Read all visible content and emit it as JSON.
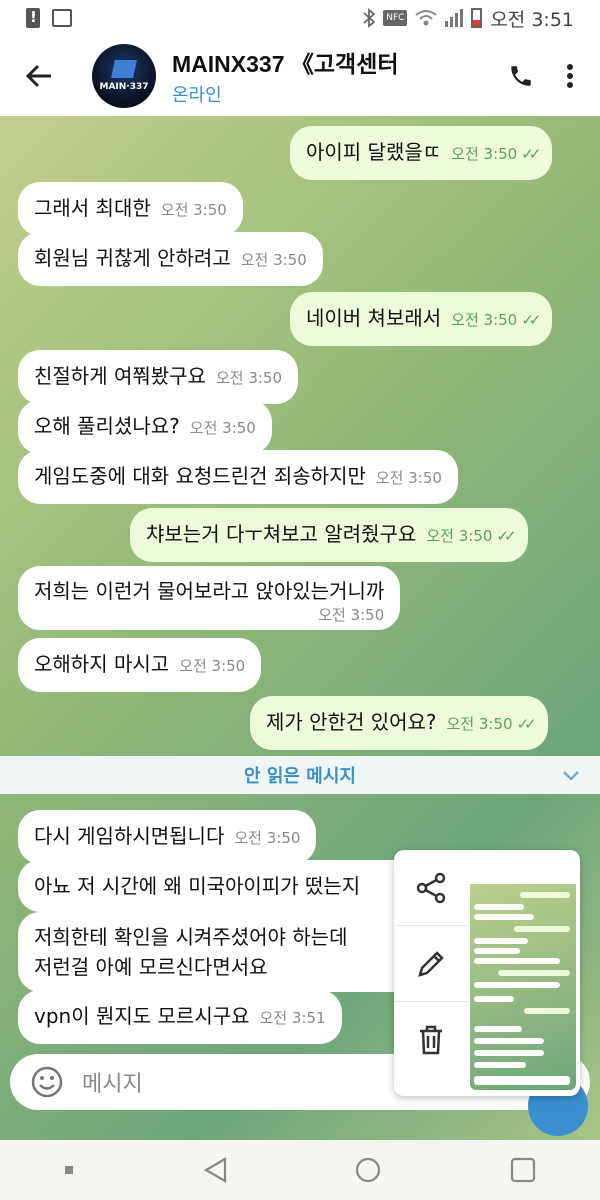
{
  "status_bar": {
    "time": "오전 3:51",
    "nfc_label": "NFC",
    "icons": [
      "alert-icon",
      "gallery-icon",
      "bluetooth-icon",
      "nfc-icon",
      "wifi-icon",
      "signal-icon",
      "battery-icon"
    ]
  },
  "header": {
    "title": "MAINX337 《고객센터",
    "status": "온라인",
    "avatar_text": "MAIN·337"
  },
  "messages": [
    {
      "dir": "out",
      "text": "아이피 달랬을ㄸ",
      "time": "오전 3:50"
    },
    {
      "dir": "in",
      "text": "그래서 최대한",
      "time": "오전 3:50"
    },
    {
      "dir": "in",
      "text": "회원님 귀찮게 안하려고",
      "time": "오전 3:50"
    },
    {
      "dir": "out",
      "text": "네이버 쳐보래서",
      "time": "오전 3:50"
    },
    {
      "dir": "in",
      "text": "친절하게 여쭤봤구요",
      "time": "오전 3:50"
    },
    {
      "dir": "in",
      "text": "오해 풀리셨나요?",
      "time": "오전 3:50"
    },
    {
      "dir": "in",
      "text": "게임도중에 대화 요청드린건 죄송하지만",
      "time": "오전 3:50"
    },
    {
      "dir": "out",
      "text": "챠보는거 다ㅜ쳐보고 알려줬구요",
      "time": "오전 3:50"
    },
    {
      "dir": "in",
      "text": "저희는 이런거 물어보라고 앉아있는거니까",
      "time": "오전 3:50"
    },
    {
      "dir": "in",
      "text": "오해하지 마시고",
      "time": "오전 3:50"
    },
    {
      "dir": "out",
      "text": "제가 안한건 있어요?",
      "time": "오전 3:50"
    }
  ],
  "unread_label": "안 읽은 메시지",
  "messages_after": [
    {
      "dir": "in",
      "text": "다시 게임하시면됩니다",
      "time": "오전 3:50"
    },
    {
      "dir": "in",
      "text": "아뇨 저 시간에 왜 미국아이피가 떴는지",
      "time": ""
    },
    {
      "dir": "in",
      "text": "저희한테 확인을 시켜주셨어야 하는데",
      "text2": "저런걸 아예 모르신다면서요",
      "time": ""
    },
    {
      "dir": "in",
      "text": "vpn이 뭔지도 모르시구요",
      "time": "오전 3:51"
    }
  ],
  "input": {
    "placeholder": "메시지"
  },
  "popup": {
    "actions": [
      "share-icon",
      "edit-icon",
      "delete-icon"
    ]
  },
  "colors": {
    "accent": "#3a8fd0",
    "outgoing_bubble": "#eefbd9",
    "tick": "#5aa25b"
  }
}
